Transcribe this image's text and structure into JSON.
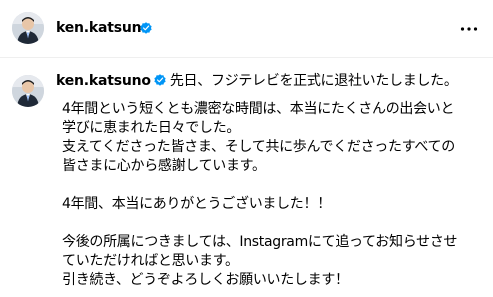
{
  "header": {
    "username": "ken.katsuno",
    "verified": true,
    "more_icon": "more-horizontal-icon"
  },
  "post": {
    "username": "ken.katsuno",
    "verified": true,
    "caption_lead": "先日、フジテレビを正式に退社いたしました。",
    "paragraphs": [
      "4年間という短くとも濃密な時間は、本当にたくさんの出会いと\n学びに恵まれた日々でした。\n支えてくださった皆さま、そして共に歩んでくださったすべての\n皆さまに心から感謝しています。",
      "4年間、本当にありがとうございました！！",
      "今後の所属につきましては、Instagramにて追ってお知らせさせ\nていただければと思います。\n引き続き、どうぞよろしくお願いいたします！"
    ]
  },
  "colors": {
    "verified_badge": "#0095f6",
    "divider": "#efefef",
    "text": "#000000"
  }
}
